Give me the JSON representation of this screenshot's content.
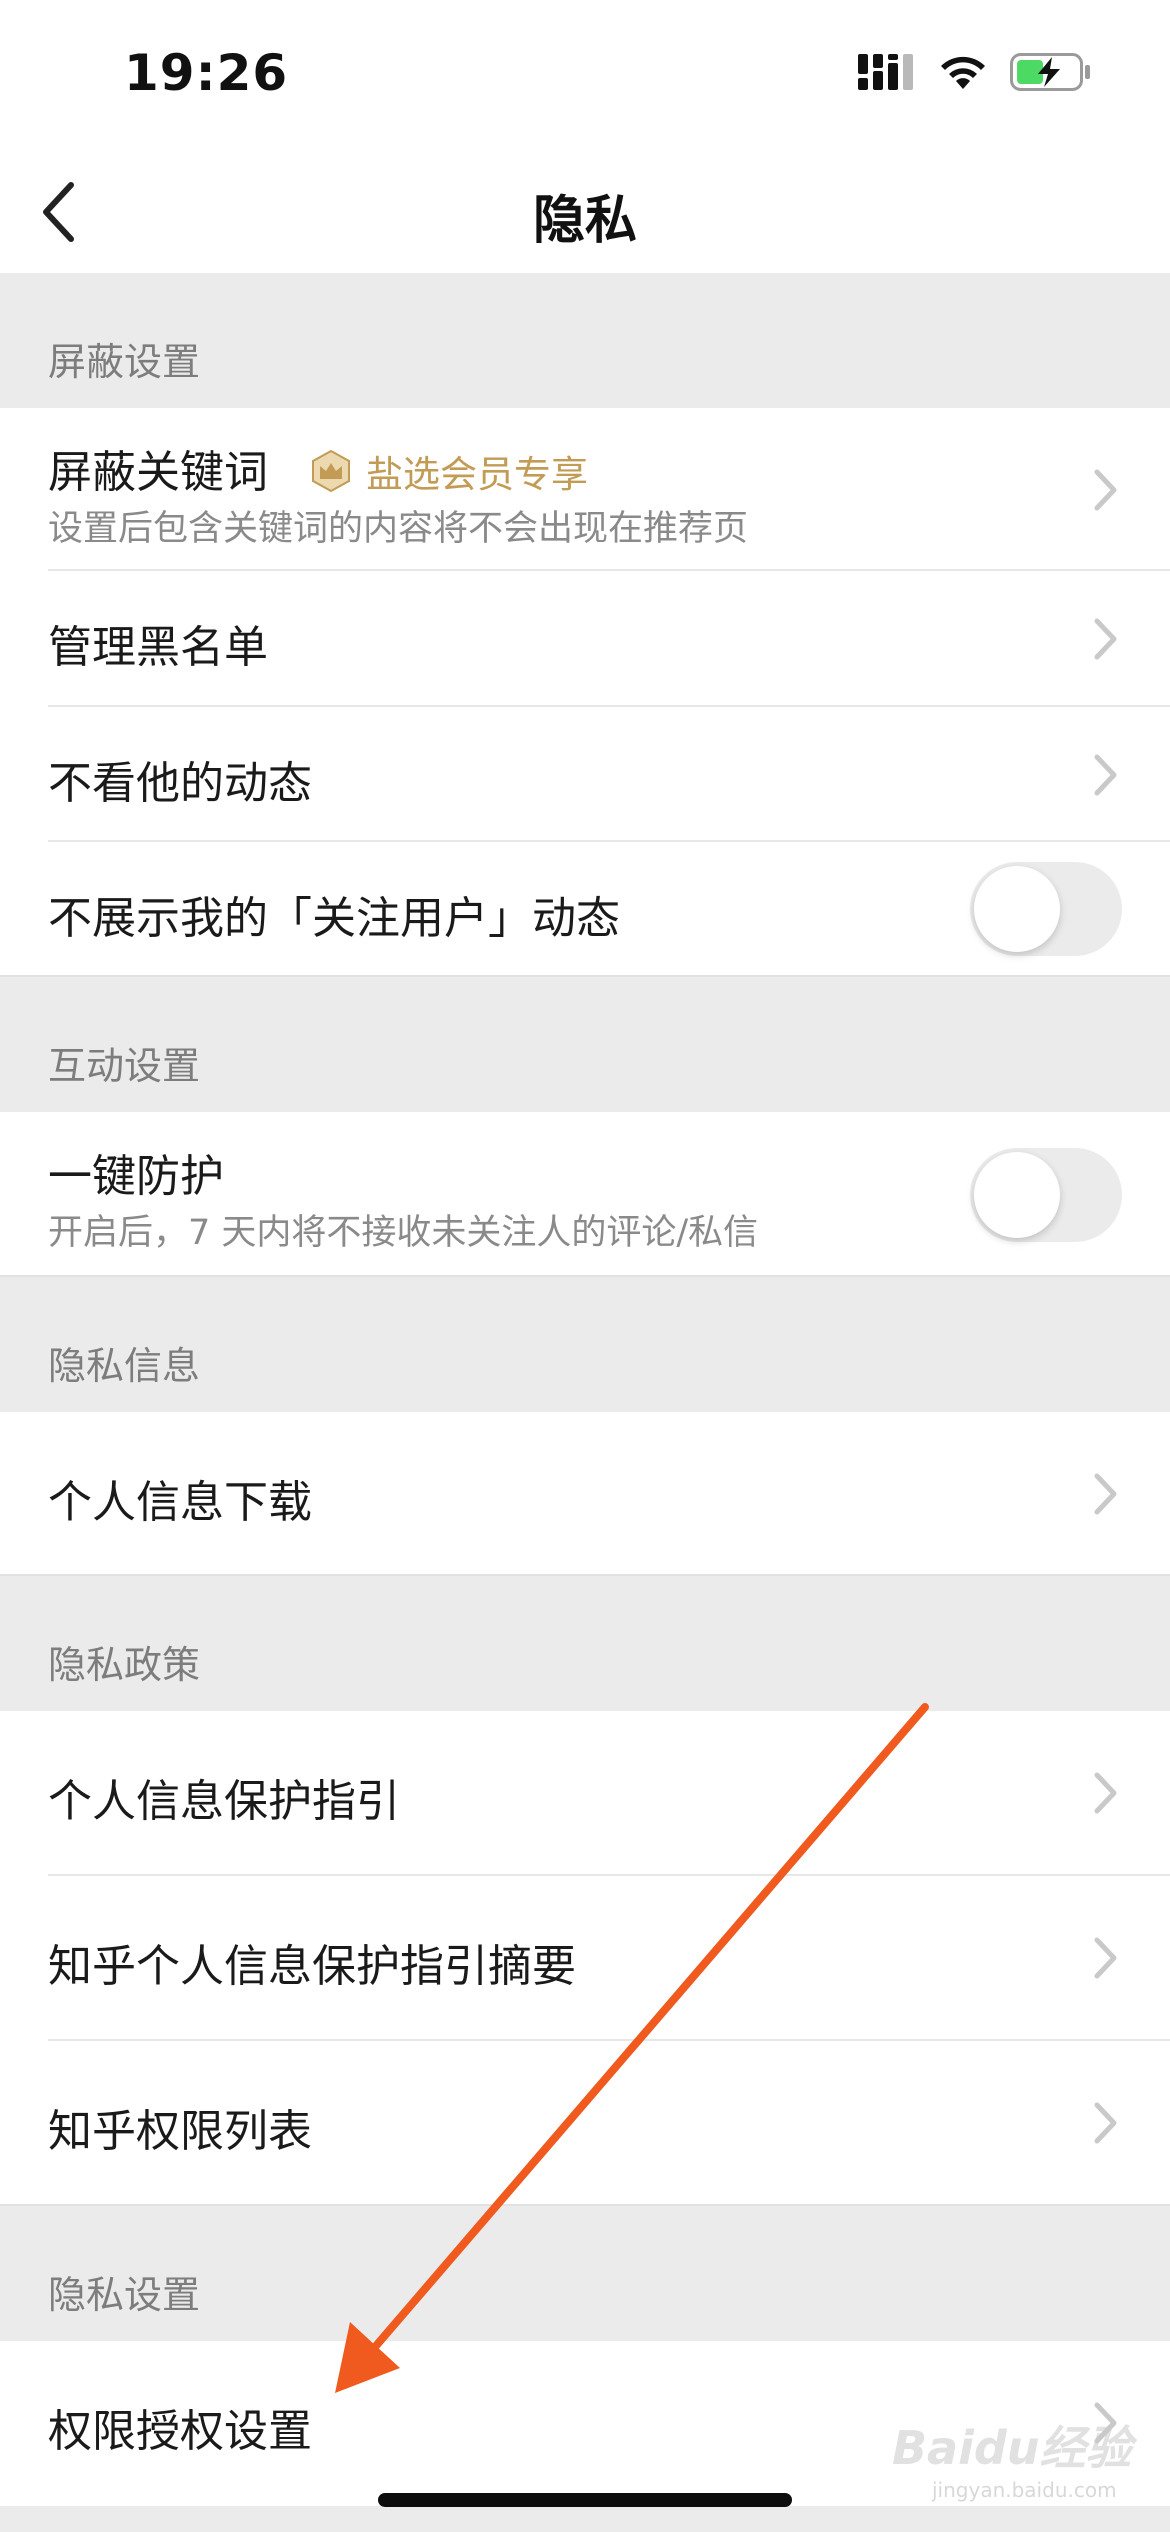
{
  "status_bar": {
    "time": "19:26",
    "icons": [
      "signal-icon",
      "wifi-icon",
      "battery-charging-icon"
    ]
  },
  "nav": {
    "title": "隐私",
    "back_icon": "chevron-left-icon"
  },
  "sections": {
    "block": {
      "header": "屏蔽设置",
      "keywords": {
        "title": "屏蔽关键词",
        "badge": "盐选会员专享",
        "subtitle": "设置后包含关键词的内容将不会出现在推荐页"
      },
      "blacklist": {
        "title": "管理黑名单"
      },
      "hide_activity": {
        "title": "不看他的动态"
      },
      "hide_follow": {
        "title": "不展示我的「关注用户」动态",
        "toggle_on": false
      }
    },
    "interaction": {
      "header": "互动设置",
      "protect": {
        "title": "一键防护",
        "subtitle": "开启后，7 天内将不接收未关注人的评论/私信",
        "toggle_on": false
      }
    },
    "privacy_info": {
      "header": "隐私信息",
      "download": {
        "title": "个人信息下载"
      }
    },
    "policy": {
      "header": "隐私政策",
      "guide": {
        "title": "个人信息保护指引"
      },
      "guide_summary": {
        "title": "知乎个人信息保护指引摘要"
      },
      "permission_list": {
        "title": "知乎权限列表"
      }
    },
    "privacy_settings": {
      "header": "隐私设置",
      "authorization": {
        "title": "权限授权设置"
      }
    }
  },
  "annotation": {
    "arrow_color": "#f05a1e"
  },
  "watermark": {
    "text": "Baidu经验",
    "sub": "jingyan.baidu.com"
  },
  "colors": {
    "vip_gold": "#c29b55",
    "background": "#ebebeb",
    "text": "#1a1a1a",
    "secondary": "#8a8a8a"
  }
}
